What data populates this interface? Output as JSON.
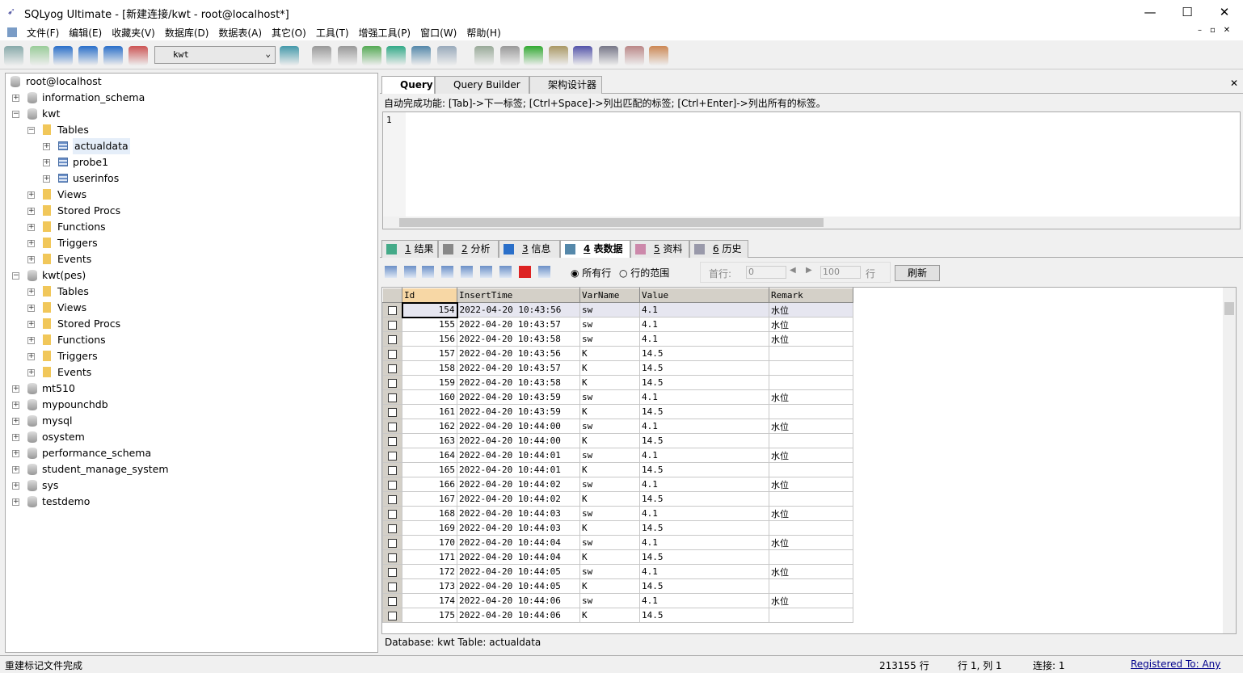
{
  "window": {
    "title": "SQLyog Ultimate - [新建连接/kwt - root@localhost*]"
  },
  "menu": [
    "文件(F)",
    "编辑(E)",
    "收藏夹(V)",
    "数据库(D)",
    "数据表(A)",
    "其它(O)",
    "工具(T)",
    "增强工具(P)",
    "窗口(W)",
    "帮助(H)"
  ],
  "toolbar": {
    "database": "kwt"
  },
  "tree": [
    {
      "label": "root@localhost",
      "level": 0,
      "type": "server"
    },
    {
      "label": "information_schema",
      "level": 0,
      "type": "db",
      "pm": "+"
    },
    {
      "label": "kwt",
      "level": 0,
      "type": "db",
      "pm": "-"
    },
    {
      "label": "Tables",
      "level": 1,
      "type": "folder",
      "pm": "-"
    },
    {
      "label": "actualdata",
      "level": 2,
      "type": "table",
      "pm": "+",
      "selected": true
    },
    {
      "label": "probe1",
      "level": 2,
      "type": "table",
      "pm": "+"
    },
    {
      "label": "userinfos",
      "level": 2,
      "type": "table",
      "pm": "+"
    },
    {
      "label": "Views",
      "level": 1,
      "type": "folder",
      "pm": "+"
    },
    {
      "label": "Stored Procs",
      "level": 1,
      "type": "folder",
      "pm": "+"
    },
    {
      "label": "Functions",
      "level": 1,
      "type": "folder",
      "pm": "+"
    },
    {
      "label": "Triggers",
      "level": 1,
      "type": "folder",
      "pm": "+"
    },
    {
      "label": "Events",
      "level": 1,
      "type": "folder",
      "pm": "+"
    },
    {
      "label": "kwt(pes)",
      "level": 0,
      "type": "db",
      "pm": "-"
    },
    {
      "label": "Tables",
      "level": 1,
      "type": "folder",
      "pm": "+"
    },
    {
      "label": "Views",
      "level": 1,
      "type": "folder",
      "pm": "+"
    },
    {
      "label": "Stored Procs",
      "level": 1,
      "type": "folder",
      "pm": "+"
    },
    {
      "label": "Functions",
      "level": 1,
      "type": "folder",
      "pm": "+"
    },
    {
      "label": "Triggers",
      "level": 1,
      "type": "folder",
      "pm": "+"
    },
    {
      "label": "Events",
      "level": 1,
      "type": "folder",
      "pm": "+"
    },
    {
      "label": "mt510",
      "level": 0,
      "type": "db",
      "pm": "+"
    },
    {
      "label": "mypounchdb",
      "level": 0,
      "type": "db",
      "pm": "+"
    },
    {
      "label": "mysql",
      "level": 0,
      "type": "db",
      "pm": "+"
    },
    {
      "label": "osystem",
      "level": 0,
      "type": "db",
      "pm": "+"
    },
    {
      "label": "performance_schema",
      "level": 0,
      "type": "db",
      "pm": "+"
    },
    {
      "label": "student_manage_system",
      "level": 0,
      "type": "db",
      "pm": "+"
    },
    {
      "label": "sys",
      "level": 0,
      "type": "db",
      "pm": "+"
    },
    {
      "label": "testdemo",
      "level": 0,
      "type": "db",
      "pm": "+"
    }
  ],
  "query_tabs": [
    "Query",
    "Query Builder",
    "架构设计器"
  ],
  "autocomplete_hint": "自动完成功能: [Tab]->下一标签; [Ctrl+Space]->列出匹配的标签; [Ctrl+Enter]->列出所有的标签。",
  "editor": {
    "line_number": "1"
  },
  "result_tabs": [
    {
      "num": "1",
      "label": "结果"
    },
    {
      "num": "2",
      "label": "分析"
    },
    {
      "num": "3",
      "label": "信息"
    },
    {
      "num": "4",
      "label": "表数据"
    },
    {
      "num": "5",
      "label": "资料"
    },
    {
      "num": "6",
      "label": "历史"
    }
  ],
  "data_toolbar": {
    "all_rows": "所有行",
    "row_range": "行的范围",
    "first_row_label": "首行:",
    "first_row": "0",
    "count": "100",
    "rows_label": "行",
    "refresh": "刷新"
  },
  "grid": {
    "columns": [
      "Id",
      "InsertTime",
      "VarName",
      "Value",
      "Remark"
    ],
    "rows": [
      [
        "154",
        "2022-04-20 10:43:56",
        "sw",
        "4.1",
        "水位"
      ],
      [
        "155",
        "2022-04-20 10:43:57",
        "sw",
        "4.1",
        "水位"
      ],
      [
        "156",
        "2022-04-20 10:43:58",
        "sw",
        "4.1",
        "水位"
      ],
      [
        "157",
        "2022-04-20 10:43:56",
        "K",
        "14.5",
        ""
      ],
      [
        "158",
        "2022-04-20 10:43:57",
        "K",
        "14.5",
        ""
      ],
      [
        "159",
        "2022-04-20 10:43:58",
        "K",
        "14.5",
        ""
      ],
      [
        "160",
        "2022-04-20 10:43:59",
        "sw",
        "4.1",
        "水位"
      ],
      [
        "161",
        "2022-04-20 10:43:59",
        "K",
        "14.5",
        ""
      ],
      [
        "162",
        "2022-04-20 10:44:00",
        "sw",
        "4.1",
        "水位"
      ],
      [
        "163",
        "2022-04-20 10:44:00",
        "K",
        "14.5",
        ""
      ],
      [
        "164",
        "2022-04-20 10:44:01",
        "sw",
        "4.1",
        "水位"
      ],
      [
        "165",
        "2022-04-20 10:44:01",
        "K",
        "14.5",
        ""
      ],
      [
        "166",
        "2022-04-20 10:44:02",
        "sw",
        "4.1",
        "水位"
      ],
      [
        "167",
        "2022-04-20 10:44:02",
        "K",
        "14.5",
        ""
      ],
      [
        "168",
        "2022-04-20 10:44:03",
        "sw",
        "4.1",
        "水位"
      ],
      [
        "169",
        "2022-04-20 10:44:03",
        "K",
        "14.5",
        ""
      ],
      [
        "170",
        "2022-04-20 10:44:04",
        "sw",
        "4.1",
        "水位"
      ],
      [
        "171",
        "2022-04-20 10:44:04",
        "K",
        "14.5",
        ""
      ],
      [
        "172",
        "2022-04-20 10:44:05",
        "sw",
        "4.1",
        "水位"
      ],
      [
        "173",
        "2022-04-20 10:44:05",
        "K",
        "14.5",
        ""
      ],
      [
        "174",
        "2022-04-20 10:44:06",
        "sw",
        "4.1",
        "水位"
      ],
      [
        "175",
        "2022-04-20 10:44:06",
        "K",
        "14.5",
        ""
      ]
    ]
  },
  "grid_status": "Database: kwt Table: actualdata",
  "status": {
    "message": "重建标记文件完成",
    "rows": "213155 行",
    "position": "行 1, 列 1",
    "connections": "连接: 1",
    "registered": "Registered To: Any"
  }
}
